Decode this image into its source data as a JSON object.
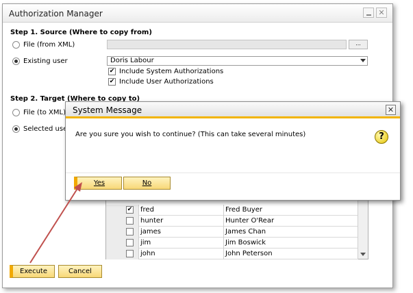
{
  "window": {
    "title": "Authorization Manager"
  },
  "step1": {
    "heading": "Step 1. Source (Where to copy from)",
    "option_file": "File (from XML)",
    "option_existing": "Existing user",
    "browse_label": "...",
    "selected_user": "Doris Labour",
    "include_system": "Include System Authorizations",
    "include_user": "Include User Authorizations"
  },
  "step2": {
    "heading": "Step 2. Target (Where to copy to)",
    "option_file": "File (to XML)",
    "option_selected": "Selected user"
  },
  "users": [
    {
      "code": "fred",
      "name": "Fred Buyer",
      "checked": true
    },
    {
      "code": "hunter",
      "name": "Hunter O'Rear",
      "checked": false
    },
    {
      "code": "james",
      "name": "James Chan",
      "checked": false
    },
    {
      "code": "jim",
      "name": "Jim Boswick",
      "checked": false
    },
    {
      "code": "john",
      "name": "John Peterson",
      "checked": false
    }
  ],
  "buttons": {
    "execute": "Execute",
    "cancel": "Cancel"
  },
  "dialog": {
    "title": "System Message",
    "message": "Are you sure you wish to continue? (This can take several minutes)",
    "yes": "Yes",
    "no": "No",
    "icon": "question-icon"
  },
  "colors": {
    "accent": "#f2b400",
    "button_fill": "#f8d878",
    "arrow": "#c0504d"
  }
}
